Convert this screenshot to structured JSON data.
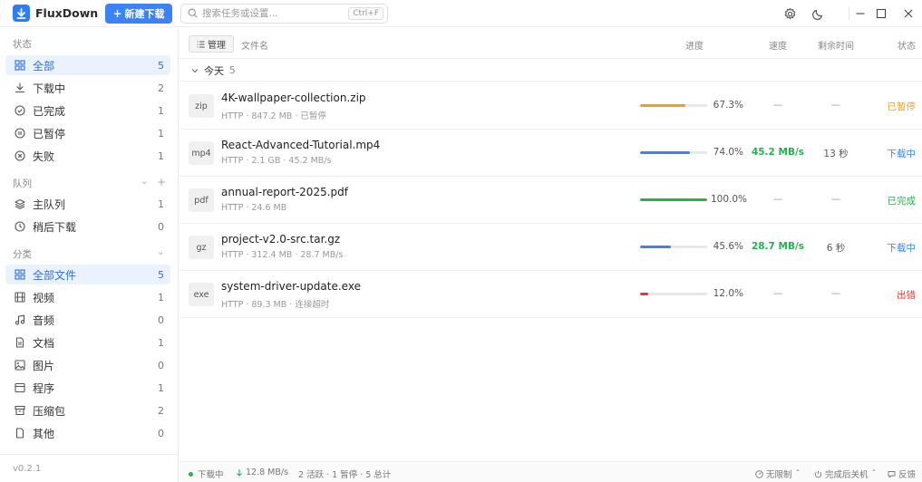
{
  "app": {
    "name": "FluxDown",
    "version": "v0.2.1"
  },
  "toolbar": {
    "new_download": "新建下载",
    "search_placeholder": "搜索任务或设置...",
    "search_shortcut": "Ctrl+F"
  },
  "sidebar": {
    "status_title": "状态",
    "status_items": [
      {
        "label": "全部",
        "count": "5",
        "icon": "grid-icon",
        "active": true
      },
      {
        "label": "下载中",
        "count": "2",
        "icon": "download-icon"
      },
      {
        "label": "已完成",
        "count": "1",
        "icon": "check-circle-icon"
      },
      {
        "label": "已暂停",
        "count": "1",
        "icon": "pause-circle-icon"
      },
      {
        "label": "失败",
        "count": "1",
        "icon": "x-circle-icon"
      }
    ],
    "queue_title": "队列",
    "queue_items": [
      {
        "label": "主队列",
        "count": "1",
        "icon": "layers-icon"
      },
      {
        "label": "稍后下载",
        "count": "0",
        "icon": "clock-icon"
      }
    ],
    "category_title": "分类",
    "category_items": [
      {
        "label": "全部文件",
        "count": "5",
        "icon": "grid-icon",
        "active": true
      },
      {
        "label": "视频",
        "count": "1",
        "icon": "film-icon"
      },
      {
        "label": "音频",
        "count": "0",
        "icon": "music-icon"
      },
      {
        "label": "文档",
        "count": "1",
        "icon": "document-icon"
      },
      {
        "label": "图片",
        "count": "0",
        "icon": "image-icon"
      },
      {
        "label": "程序",
        "count": "1",
        "icon": "app-window-icon"
      },
      {
        "label": "压缩包",
        "count": "2",
        "icon": "archive-icon"
      },
      {
        "label": "其他",
        "count": "0",
        "icon": "file-icon"
      }
    ]
  },
  "table": {
    "manage_label": "管理",
    "columns": {
      "name": "文件名",
      "progress": "进度",
      "speed": "速度",
      "eta": "剩余时间",
      "status": "状态"
    },
    "group": {
      "label": "今天",
      "count": "5"
    },
    "rows": [
      {
        "ext": "zip",
        "name": "4K-wallpaper-collection.zip",
        "meta": "HTTP · 847.2 MB · 已暂停",
        "progress": 0.673,
        "progress_text": "67.3%",
        "bar_color": "#f0a020",
        "speed": "—",
        "eta": "—",
        "status": "已暂停",
        "status_color": "#f0a020"
      },
      {
        "ext": "mp4",
        "name": "React-Advanced-Tutorial.mp4",
        "meta": "HTTP · 2.1 GB · 45.2 MB/s",
        "progress": 0.74,
        "progress_text": "74.0%",
        "bar_color": "#3b82f6",
        "speed": "45.2 MB/s",
        "eta": "13 秒",
        "status": "下载中",
        "status_color": "#3b82f6",
        "active": true
      },
      {
        "ext": "pdf",
        "name": "annual-report-2025.pdf",
        "meta": "HTTP · 24.6 MB",
        "progress": 1.0,
        "progress_text": "100.0%",
        "bar_color": "#22b34c",
        "speed": "—",
        "eta": "—",
        "status": "已完成",
        "status_color": "#22b34c"
      },
      {
        "ext": "gz",
        "name": "project-v2.0-src.tar.gz",
        "meta": "HTTP · 312.4 MB · 28.7 MB/s",
        "progress": 0.456,
        "progress_text": "45.6%",
        "bar_color": "#3b82f6",
        "speed": "28.7 MB/s",
        "eta": "6 秒",
        "status": "下载中",
        "status_color": "#3b82f6",
        "active": true
      },
      {
        "ext": "exe",
        "name": "system-driver-update.exe",
        "meta": "HTTP · 89.3 MB · 连接超时",
        "progress": 0.12,
        "progress_text": "12.0%",
        "bar_color": "#e53935",
        "speed": "—",
        "eta": "—",
        "status": "出错",
        "status_color": "#e53935"
      }
    ]
  },
  "footer": {
    "state": "下载中",
    "speed": "12.8 MB/s",
    "summary": "2 活跃 · 1 暂停 · 5 总计",
    "limit": "无限制",
    "after_done": "完成后关机",
    "feedback": "反馈"
  }
}
